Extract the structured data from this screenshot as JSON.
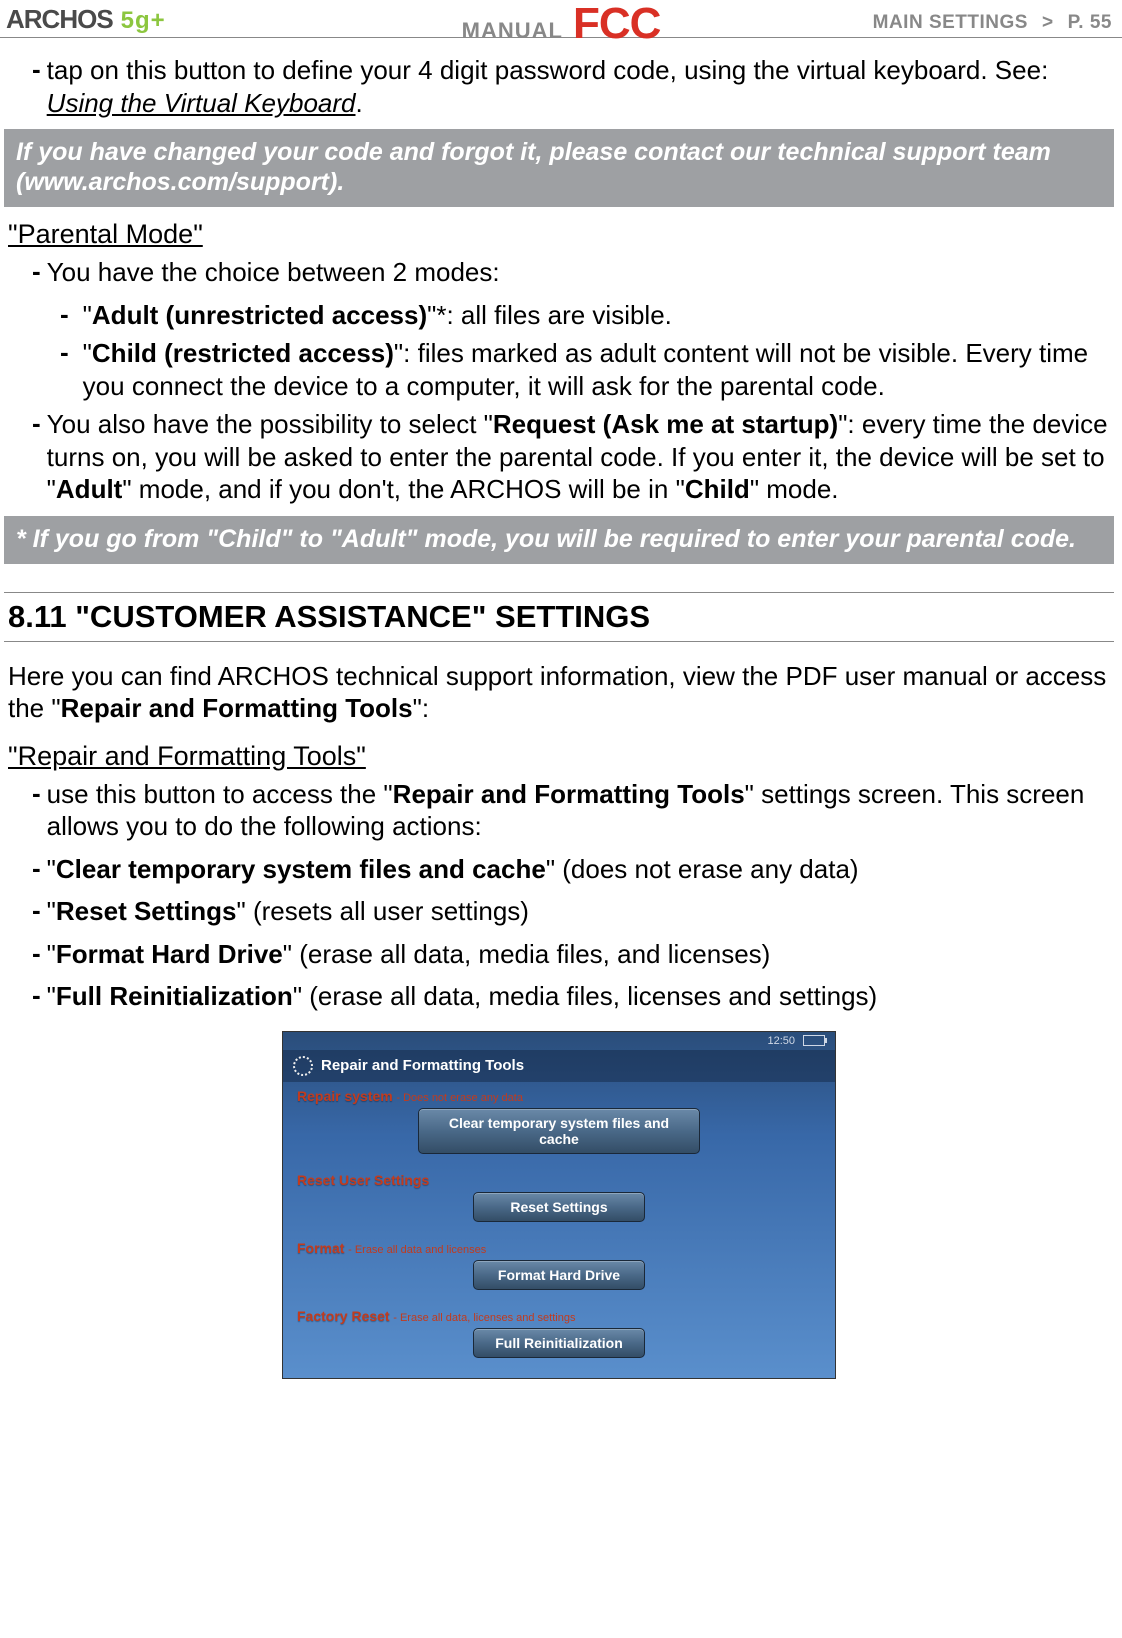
{
  "header": {
    "brand": "ARCHOS",
    "model": "5g+",
    "manual_label": "MANUAL",
    "fcc_label": "FCC",
    "breadcrumb_section": "MAIN SETTINGS",
    "breadcrumb_sep": ">",
    "page_label": "P. 55"
  },
  "intro_bullet": {
    "text_a": "tap on this button to define your 4 digit password code, using the virtual keyboard. See: ",
    "link": "Using the Virtual Keyboard",
    "text_b": "."
  },
  "callout1": "If you have changed your code and forgot it, please contact our technical support team (www.archos.com/support).",
  "parental": {
    "heading": "\"Parental Mode\"",
    "choice_intro": "You have the choice between 2 modes:",
    "mode1_prefix": "\"",
    "mode1_bold": "Adult (unrestricted access)",
    "mode1_suffix": "\"*: all files are visible.",
    "mode2_prefix": "\"",
    "mode2_bold": "Child (restricted access)",
    "mode2_suffix": "\": files marked as adult content will not be visible. Every time you connect the device to a computer, it will ask for the parental code.",
    "also_a": "You also have the possibility to select \"",
    "also_bold1": "Request (Ask me at startup)",
    "also_b": "\": every time the device turns on, you will be asked to enter the parental code. If you enter it, the device will be set to \"",
    "also_bold2": "Adult",
    "also_c": "\" mode, and if you don't, the ARCHOS will be in \"",
    "also_bold3": "Child",
    "also_d": "\" mode."
  },
  "callout2": "* If you go from \"Child\" to \"Adult\" mode, you will be required to enter your parental code.",
  "section": {
    "title": "8.11 \"CUSTOMER ASSISTANCE\" SETTINGS",
    "intro_a": "Here you can find ARCHOS technical support information, view the PDF user manual or access the \"",
    "intro_bold": "Repair and Formatting Tools",
    "intro_b": "\":"
  },
  "repair": {
    "heading": "\"Repair and Formatting Tools\"",
    "b1_a": "use this button to access the \"",
    "b1_bold": "Repair and Formatting Tools",
    "b1_b": "\" settings screen. This screen allows you to do the following actions:",
    "b2_a": "\"",
    "b2_bold": "Clear temporary system files and cache",
    "b2_b": "\" (does not erase any data)",
    "b3_a": "\"",
    "b3_bold": "Reset Settings",
    "b3_b": "\" (resets all user settings)",
    "b4_a": "\"",
    "b4_bold": "Format Hard Drive",
    "b4_b": "\" (erase all data, media files, and licenses)",
    "b5_a": "\"",
    "b5_bold": "Full Reinitialization",
    "b5_b": "\" (erase all data, media files, licenses and settings)"
  },
  "device_ui": {
    "time": "12:50",
    "title": "Repair and Formatting Tools",
    "sections": [
      {
        "label": "Repair system",
        "sublabel": "Does not erase any data",
        "button": "Clear temporary system files and cache"
      },
      {
        "label": "Reset User Settings",
        "sublabel": "",
        "button": "Reset Settings"
      },
      {
        "label": "Format",
        "sublabel": "Erase all data and licenses",
        "button": "Format Hard Drive"
      },
      {
        "label": "Factory Reset",
        "sublabel": "Erase all data, licenses and settings",
        "button": "Full Reinitialization"
      }
    ]
  }
}
